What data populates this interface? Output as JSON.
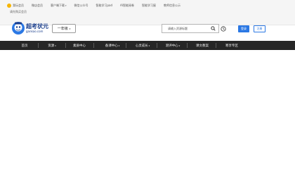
{
  "topbar": {
    "items": [
      {
        "label": "我玩会员",
        "icon": "bulb-icon"
      },
      {
        "label": "微店会员"
      },
      {
        "label": "客户端下载",
        "has_dropdown": true
      },
      {
        "label": "微信公众号"
      },
      {
        "label": "智能学习pad"
      },
      {
        "label": "AI智能阅卷"
      },
      {
        "label": "智能学习屋"
      },
      {
        "label": "教师信息公示"
      }
    ],
    "subline": "请先购买会员"
  },
  "logo": {
    "title": "超考状元",
    "url": "gankao.com",
    "icon": "mascot-icon"
  },
  "grade_select": {
    "value": "一年级"
  },
  "search": {
    "placeholder": "请输入资源标题",
    "icon": "search-icon"
  },
  "auth": {
    "login_label": "登录",
    "register_label": "注册"
  },
  "nav": {
    "items": [
      {
        "label": "首页",
        "has_dropdown": false
      },
      {
        "label": "资源",
        "has_dropdown": true
      },
      {
        "label": "素质中心",
        "has_dropdown": false
      },
      {
        "label": "备课中心",
        "has_dropdown": true
      },
      {
        "label": "心灵成长",
        "has_dropdown": true
      },
      {
        "label": "测评中心",
        "has_dropdown": true
      },
      {
        "label": "课文教案",
        "has_dropdown": false
      },
      {
        "label": "寒享专区",
        "has_dropdown": false
      }
    ]
  },
  "colors": {
    "brand_blue": "#2b78e4",
    "nav_bg": "#262626",
    "logo_text": "#1a3e8c"
  }
}
